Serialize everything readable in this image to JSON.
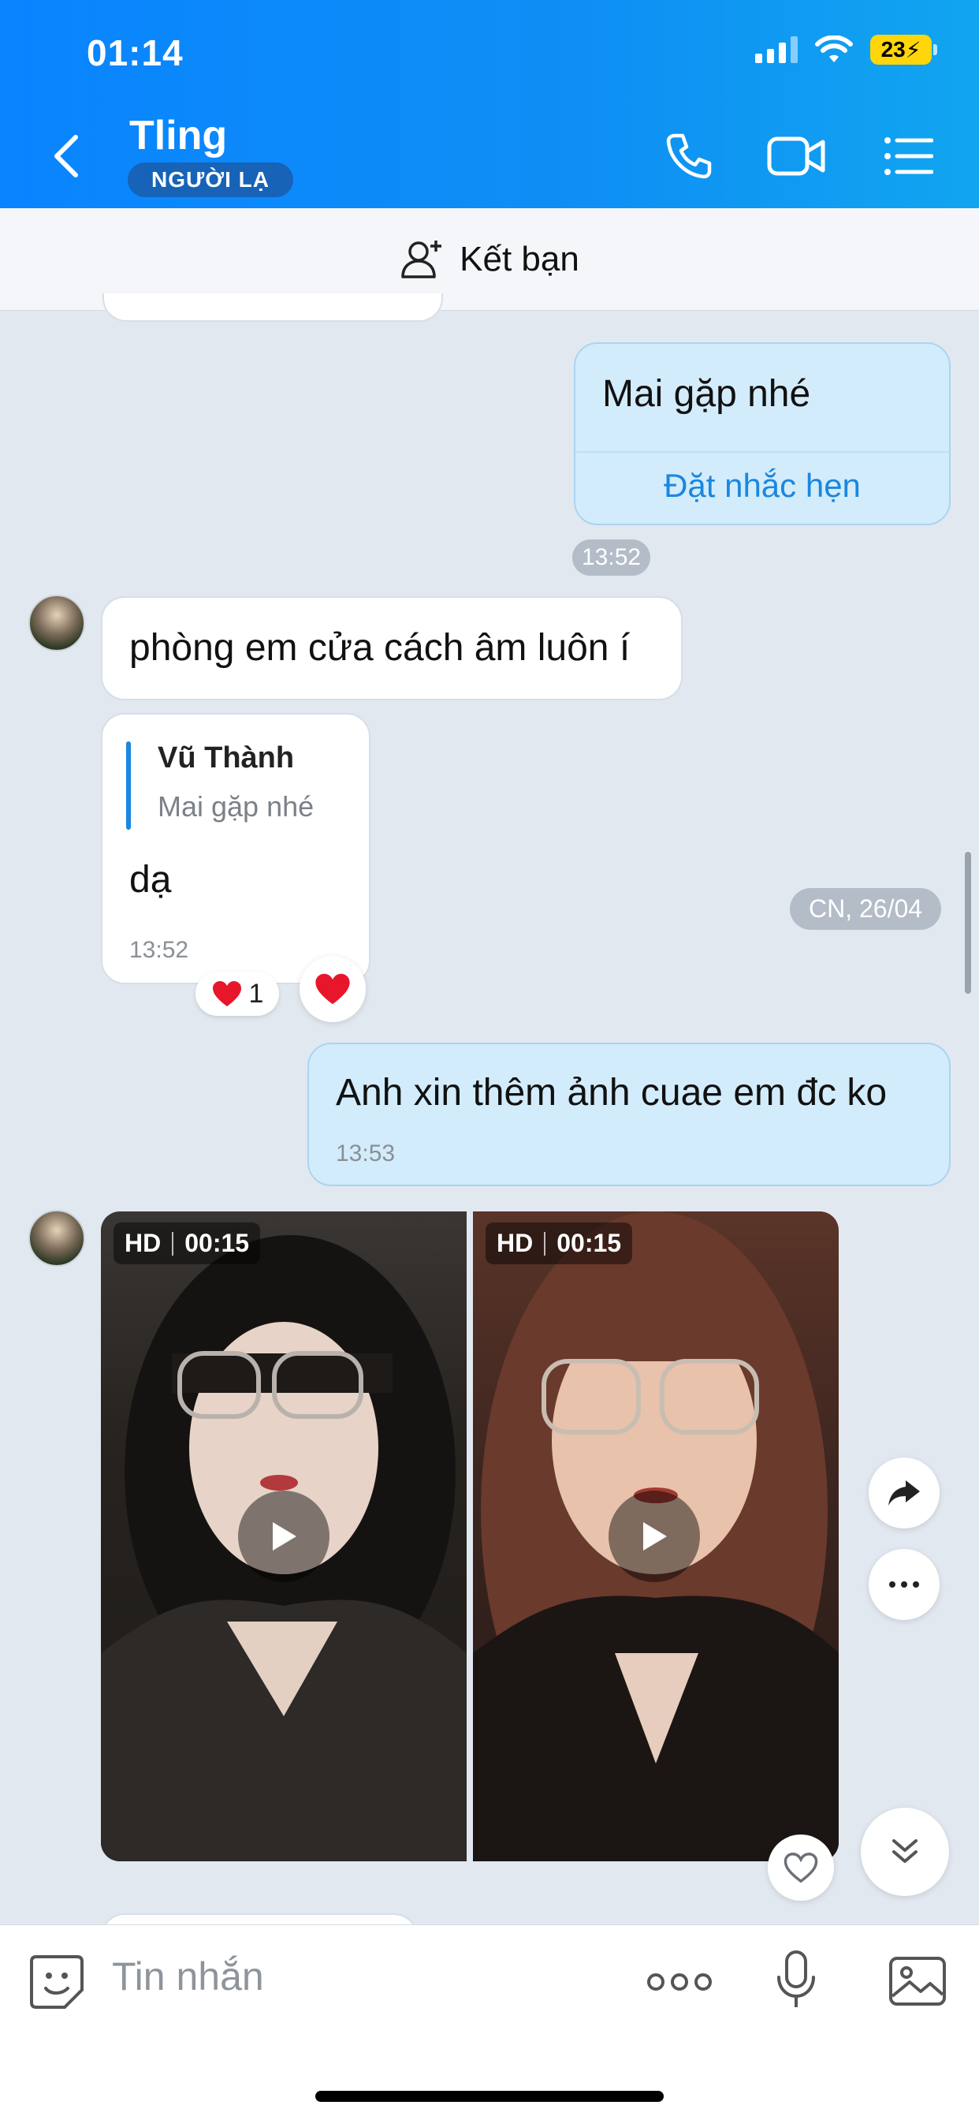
{
  "status_bar": {
    "time": "01:14",
    "battery": "23"
  },
  "header": {
    "title": "Tling",
    "badge": "NGƯỜI LẠ"
  },
  "add_friend": {
    "label": "Kết bạn"
  },
  "messages": {
    "m1": {
      "text": "Mai gặp nhé",
      "action": "Đặt nhắc hẹn",
      "time": "13:52"
    },
    "m2": {
      "text": "phòng em cửa cách âm luôn í"
    },
    "m3": {
      "quote_author": "Vũ Thành",
      "quote_text": "Mai gặp nhé",
      "text": "dạ",
      "time": "13:52",
      "reaction_count": "1"
    },
    "date_pill": "CN, 26/04",
    "m4": {
      "text": "Anh xin thêm ảnh cuae em đc ko",
      "time": "13:53"
    },
    "videos": [
      {
        "quality": "HD",
        "duration": "00:15"
      },
      {
        "quality": "HD",
        "duration": "00:15"
      }
    ]
  },
  "input": {
    "placeholder": "Tin nhắn"
  },
  "colors": {
    "header_blue": "#0a84ff",
    "my_bubble": "#d3ecfb",
    "link_blue": "#1a87e0"
  }
}
